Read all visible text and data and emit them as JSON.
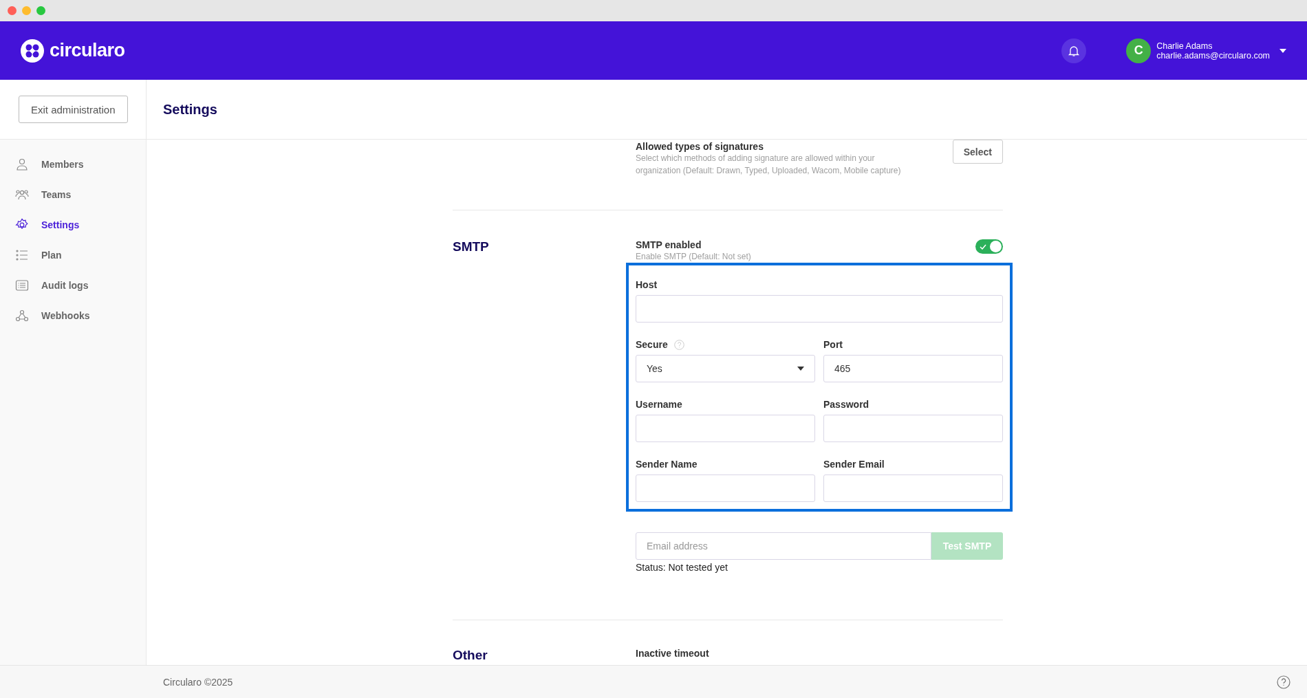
{
  "header": {
    "brand": "circularo",
    "user": {
      "initial": "C",
      "name": "Charlie Adams",
      "email": "charlie.adams@circularo.com"
    }
  },
  "sidebar": {
    "exit_button": "Exit administration",
    "items": [
      {
        "label": "Members",
        "selected": false
      },
      {
        "label": "Teams",
        "selected": false
      },
      {
        "label": "Settings",
        "selected": true
      },
      {
        "label": "Plan",
        "selected": false
      },
      {
        "label": "Audit logs",
        "selected": false
      },
      {
        "label": "Webhooks",
        "selected": false
      }
    ]
  },
  "page_title": "Settings",
  "signatures": {
    "title": "Allowed types of signatures",
    "description": "Select which methods of adding signature are allowed within your organization  (Default: Drawn, Typed, Uploaded, Wacom, Mobile capture)",
    "button": "Select"
  },
  "smtp": {
    "title": "SMTP",
    "toggle": {
      "label": "SMTP enabled",
      "description": "Enable SMTP  (Default: Not set)",
      "on": true
    },
    "highlighted": true,
    "rows": [
      [
        {
          "kind": "text",
          "label": "Host",
          "help": false
        }
      ],
      [
        {
          "kind": "select",
          "label": "Secure",
          "value": "Yes",
          "help": true
        },
        {
          "kind": "text",
          "label": "Port",
          "value": "465",
          "help": false
        }
      ],
      [
        {
          "kind": "text",
          "label": "Username",
          "help": false
        },
        {
          "kind": "text",
          "label": "Password",
          "help": false
        }
      ],
      [
        {
          "kind": "text",
          "label": "Sender Name",
          "help": false
        },
        {
          "kind": "text",
          "label": "Sender Email",
          "help": false
        }
      ]
    ],
    "test": {
      "placeholder": "Email address",
      "button": "Test SMTP",
      "disabled": true
    },
    "status": "Status: Not tested yet"
  },
  "other": {
    "title": "Other",
    "field_label": "Inactive timeout"
  },
  "footer": {
    "copyright": "Circularo ©2025"
  }
}
